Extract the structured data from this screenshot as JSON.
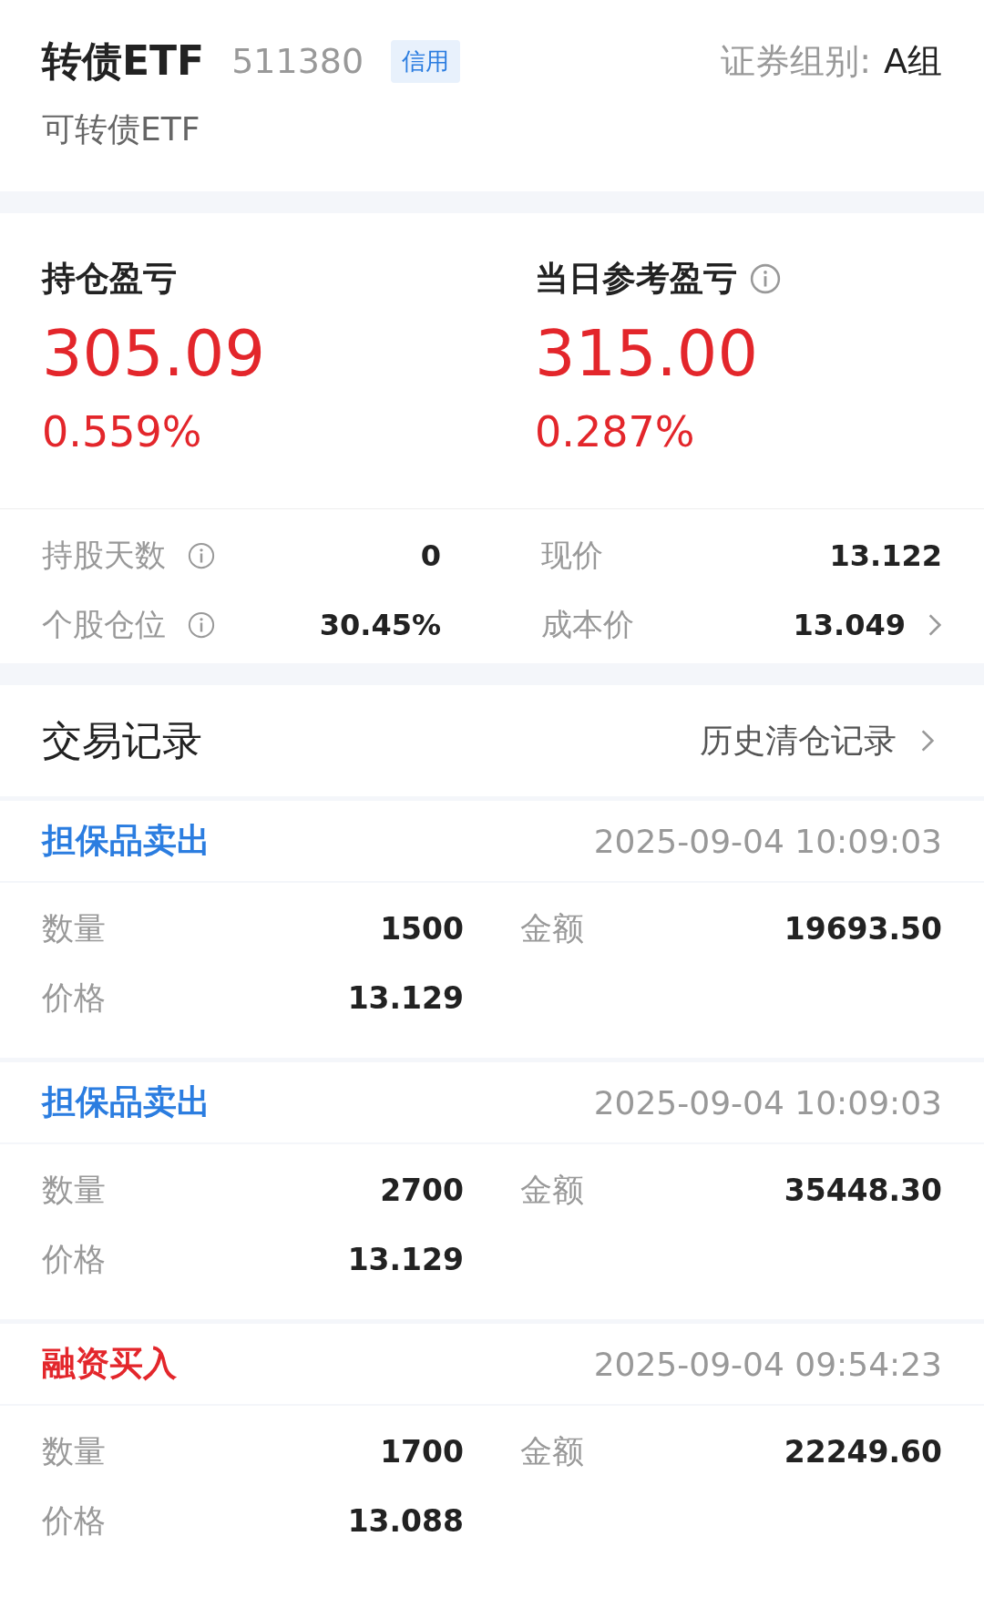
{
  "header": {
    "title": "转债ETF",
    "code": "511380",
    "tag": "信用",
    "group_label": "证券组别:",
    "group_value": "A组",
    "subtitle": "可转债ETF"
  },
  "pnl": [
    {
      "label": "持仓盈亏",
      "info": false,
      "value": "305.09",
      "percent": "0.559%"
    },
    {
      "label": "当日参考盈亏",
      "info": true,
      "value": "315.00",
      "percent": "0.287%"
    }
  ],
  "stats": [
    {
      "label": "持股天数",
      "info": true,
      "value": "0",
      "arrow": false
    },
    {
      "label": "现价",
      "info": false,
      "value": "13.122",
      "arrow": false
    },
    {
      "label": "个股仓位",
      "info": true,
      "value": "30.45%",
      "arrow": false
    },
    {
      "label": "成本价",
      "info": false,
      "value": "13.049",
      "arrow": true
    }
  ],
  "trades_title": "交易记录",
  "history_link": "历史清仓记录",
  "trades": [
    {
      "type": "担保品卖出",
      "color": "#2b7de0",
      "time": "2025-09-04 10:09:03",
      "fields": [
        {
          "label": "数量",
          "value": "1500"
        },
        {
          "label": "金额",
          "value": "19693.50"
        },
        {
          "label": "价格",
          "value": "13.129"
        }
      ]
    },
    {
      "type": "担保品卖出",
      "color": "#2b7de0",
      "time": "2025-09-04 10:09:03",
      "fields": [
        {
          "label": "数量",
          "value": "2700"
        },
        {
          "label": "金额",
          "value": "35448.30"
        },
        {
          "label": "价格",
          "value": "13.129"
        }
      ]
    },
    {
      "type": "融资买入",
      "color": "#e3262b",
      "time": "2025-09-04 09:54:23",
      "fields": [
        {
          "label": "数量",
          "value": "1700"
        },
        {
          "label": "金额",
          "value": "22249.60"
        },
        {
          "label": "价格",
          "value": "13.088"
        }
      ]
    }
  ]
}
